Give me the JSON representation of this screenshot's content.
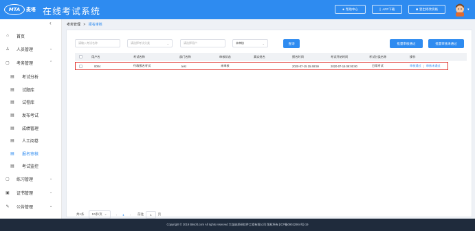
{
  "header": {
    "logo_text": "MTA",
    "logo_cn": "麦塔",
    "app_title": "在线考试系统",
    "buttons": [
      {
        "icon": "help-icon",
        "label": "帮助中心"
      },
      {
        "icon": "phone-icon",
        "label": "APP下载"
      },
      {
        "icon": "logout-icon",
        "label": "登出修改资格"
      }
    ]
  },
  "sidebar": {
    "items": [
      {
        "icon": "home-icon",
        "label": "首页"
      },
      {
        "icon": "user-icon",
        "label": "人员管理"
      },
      {
        "icon": "exam-icon",
        "label": "考务管理"
      },
      {
        "icon": "analysis-icon",
        "label": "考试分析"
      },
      {
        "icon": "question-bank-icon",
        "label": "试题库"
      },
      {
        "icon": "paper-bank-icon",
        "label": "试卷库"
      },
      {
        "icon": "publish-icon",
        "label": "发布考试"
      },
      {
        "icon": "score-icon",
        "label": "成绩管理"
      },
      {
        "icon": "grading-icon",
        "label": "人工阅卷"
      },
      {
        "icon": "review-icon",
        "label": "报名审核"
      },
      {
        "icon": "monitor-icon",
        "label": "考试监控"
      },
      {
        "icon": "practice-icon",
        "label": "练习管理"
      },
      {
        "icon": "certificate-icon",
        "label": "证书管理"
      },
      {
        "icon": "notice-icon",
        "label": "公告管理"
      }
    ]
  },
  "breadcrumb": {
    "parent": "考务管理",
    "separator": ">",
    "current": "报名审核"
  },
  "filters": {
    "name_placeholder": "请输入考试名称",
    "category_placeholder": "请选择考试分类",
    "user_placeholder": "请选择用户",
    "status_value": "未审核",
    "search_label": "查询",
    "batch_approve_label": "批量审核通过",
    "batch_reject_label": "批量审核未通过"
  },
  "table": {
    "headers": [
      "用户名",
      "考试名称",
      "部门名称",
      "审核状态",
      "真实姓名",
      "报名时间",
      "考试开始时间",
      "考试分类名称",
      "操作"
    ],
    "rows": [
      {
        "username": "0004",
        "exam_name": "行政报名考试",
        "department": "test",
        "status": "未审核",
        "real_name": "",
        "signup_time": "2020-07-15 15:48:59",
        "start_time": "2020-07-16 09:00:00",
        "category": "日常考试",
        "op_approve": "审核通过",
        "op_sep": "|",
        "op_reject": "审核未通过"
      }
    ]
  },
  "pager": {
    "total": "共1条",
    "page_size": "10条/页",
    "current": "1",
    "goto_label": "前往",
    "goto_value": "1",
    "page_suffix": "页"
  },
  "footer": {
    "text": "Copyright © 2019 Bksoft.com All rights reserved 大连纳邦研软件工程有限公司 版权所有 [ICP备09022904号]-19"
  },
  "colors": {
    "primary": "#2e8bf0",
    "highlight_border": "#e0302b",
    "footer_bg": "#1f2b3c"
  }
}
